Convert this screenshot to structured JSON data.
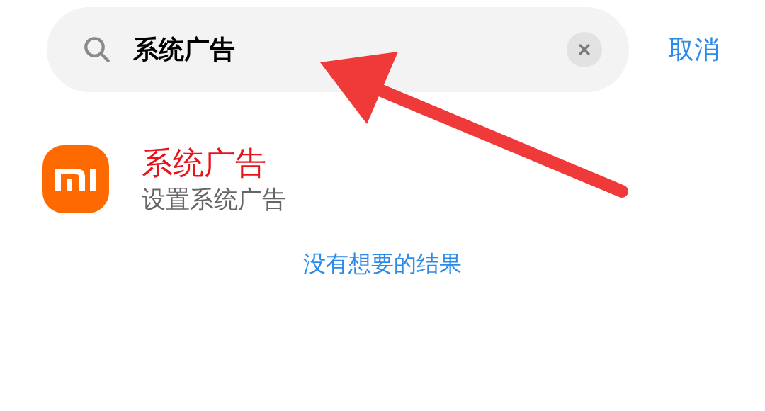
{
  "search": {
    "value": "系统广告",
    "cancel": "取消"
  },
  "results": [
    {
      "title": "系统广告",
      "subtitle": "设置系统广告"
    }
  ],
  "no_result_link": "没有想要的结果"
}
